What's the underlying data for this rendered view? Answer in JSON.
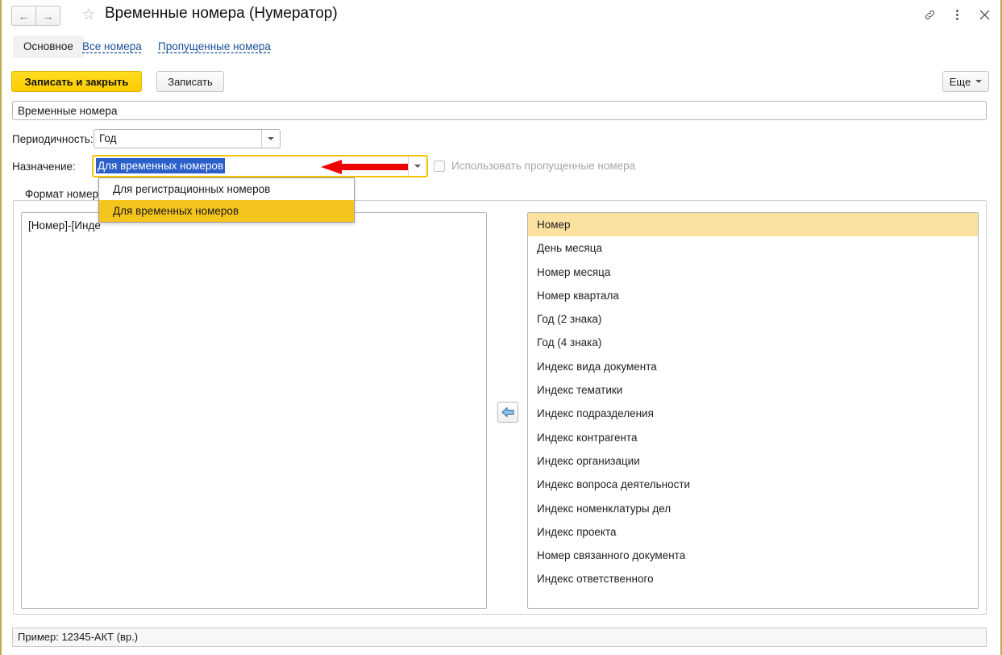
{
  "window": {
    "title": "Временные номера (Нумератор)",
    "back_icon": "arrow-left-icon",
    "forward_icon": "arrow-right-icon",
    "favorite_icon": "star-icon",
    "link_icon": "link-icon",
    "menu_icon": "kebab-menu-icon",
    "close_icon": "close-icon"
  },
  "tabs": {
    "main": "Основное",
    "links": [
      "Все номера",
      "Пропущенные номера"
    ]
  },
  "toolbar": {
    "save_and_close": "Записать и закрыть",
    "save": "Записать",
    "more": "Еще",
    "more_caret_icon": "chevron-down-icon"
  },
  "form": {
    "name_value": "Временные номера",
    "periodicity_label": "Периодичность:",
    "periodicity_value": "Год",
    "periodicity_caret_icon": "chevron-down-icon",
    "purpose_label": "Назначение:",
    "purpose_value": "Для временных номеров",
    "purpose_caret_icon": "chevron-down-icon",
    "use_skipped_label": "Использовать пропущенные номера",
    "use_skipped_checked": false,
    "annotation_icon": "red-arrow-left"
  },
  "dropdown": {
    "open": true,
    "options": [
      {
        "label": "Для регистрационных номеров",
        "selected": false
      },
      {
        "label": "Для временных номеров",
        "selected": true
      }
    ]
  },
  "tab_group": {
    "label": "Формат номера"
  },
  "format_panel": {
    "text": "[Номер]-[Инде"
  },
  "transfer": {
    "icon": "arrow-left-blue-icon"
  },
  "elements_list": [
    {
      "label": "Номер",
      "selected": true
    },
    {
      "label": "День месяца",
      "selected": false
    },
    {
      "label": "Номер месяца",
      "selected": false
    },
    {
      "label": "Номер квартала",
      "selected": false
    },
    {
      "label": "Год (2 знака)",
      "selected": false
    },
    {
      "label": "Год (4 знака)",
      "selected": false
    },
    {
      "label": "Индекс вида документа",
      "selected": false
    },
    {
      "label": "Индекс тематики",
      "selected": false
    },
    {
      "label": "Индекс подразделения",
      "selected": false
    },
    {
      "label": "Индекс контрагента",
      "selected": false
    },
    {
      "label": "Индекс организации",
      "selected": false
    },
    {
      "label": "Индекс вопроса деятельности",
      "selected": false
    },
    {
      "label": "Индекс номенклатуры дел",
      "selected": false
    },
    {
      "label": "Индекс проекта",
      "selected": false
    },
    {
      "label": "Номер связанного документа",
      "selected": false
    },
    {
      "label": "Индекс ответственного",
      "selected": false
    }
  ],
  "status": {
    "text": "Пример: 12345-АКТ (вр.)"
  },
  "colors": {
    "accent_yellow": "#ffcc00",
    "focus_gold": "#f5c400",
    "selection_blue": "#2b5fc9",
    "row_highlight": "#fbe2a0",
    "dropdown_selected": "#f5c41d",
    "annotation_red": "#ee0000",
    "window_border": "#bfa94a"
  }
}
